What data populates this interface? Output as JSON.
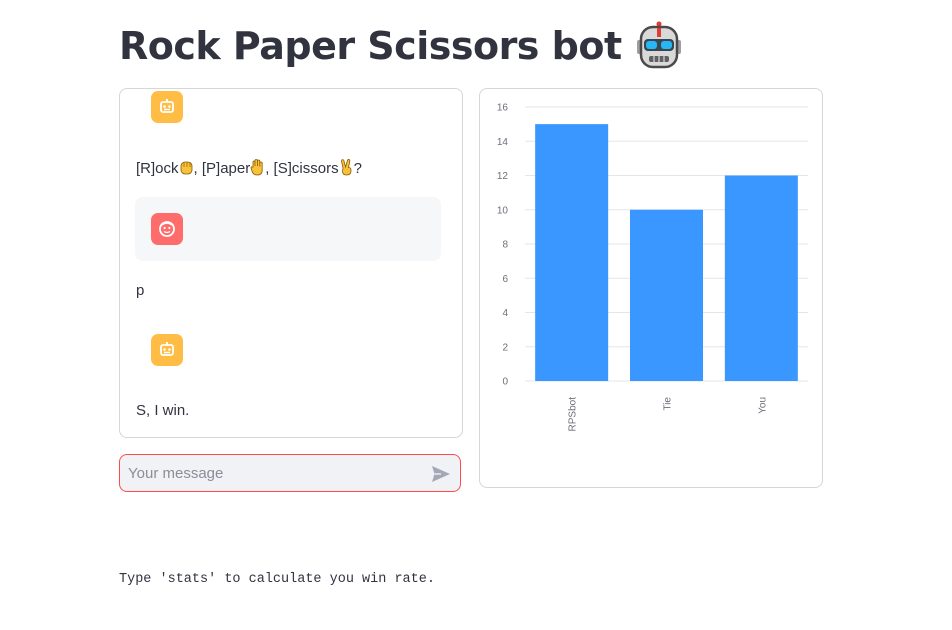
{
  "page": {
    "title": "Rock Paper Scissors bot",
    "title_emoji": "robot-face-emoji"
  },
  "chat": {
    "messages": [
      {
        "role": "assistant",
        "avatar_icon": "bot-icon",
        "text_parts": [
          "[R]ock",
          ", [P]aper",
          ", [S]cissors",
          "?"
        ]
      },
      {
        "role": "user",
        "avatar_icon": "user-face-icon",
        "text": "p"
      },
      {
        "role": "assistant",
        "avatar_icon": "bot-icon",
        "text": "S, I win."
      }
    ]
  },
  "input": {
    "placeholder": "Your message",
    "value": "",
    "send_icon": "send-icon"
  },
  "footer": {
    "text": "Type 'stats' to calculate you win rate."
  },
  "colors": {
    "bar": "#3a97ff",
    "bot_avatar": "#ffbd45",
    "user_avatar": "#ff6c6c",
    "input_border": "#ff4b4b"
  },
  "chart_data": {
    "type": "bar",
    "categories": [
      "RPSbot",
      "Tie",
      "You"
    ],
    "values": [
      15,
      10,
      12
    ],
    "ylim": [
      0,
      16
    ],
    "yticks": [
      0,
      2,
      4,
      6,
      8,
      10,
      12,
      14,
      16
    ],
    "title": "",
    "xlabel": "",
    "ylabel": "",
    "grid": true,
    "legend": "none"
  }
}
